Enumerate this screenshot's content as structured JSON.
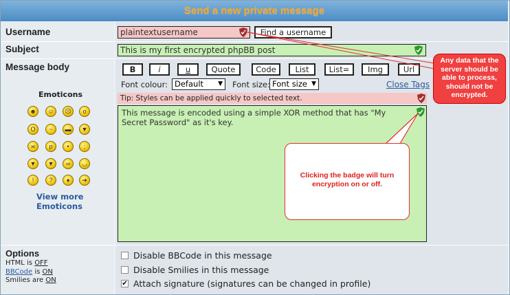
{
  "header": {
    "title": "Send a new private message"
  },
  "username": {
    "label": "Username",
    "value": "plaintextusername",
    "find_button": "Find a username"
  },
  "subject": {
    "label": "Subject",
    "value": "This is my first encrypted phpBB post"
  },
  "message": {
    "label": "Message body",
    "body": "This message is encoded using a simple XOR method that has \"My Secret Password\" as it's key.",
    "tip": "Tip: Styles can be applied quickly to selected text."
  },
  "toolbar": {
    "buttons": [
      "B",
      "i",
      "u",
      "Quote",
      "Code",
      "List",
      "List=",
      "Img",
      "Url"
    ],
    "font_colour_label": "Font colour:",
    "font_colour_value": "Default",
    "font_size_label": "Font size:",
    "font_size_value": "Font size",
    "close_tags": "Close Tags"
  },
  "emoticons": {
    "title": "Emoticons",
    "view_more_line1": "View more",
    "view_more_line2": "Emoticons",
    "faces": [
      "grin",
      "smile",
      "sad",
      "surprised",
      "eek",
      "confused",
      "cool",
      "laughing",
      "mad",
      "razz",
      "embarrassed",
      "crying",
      "evil",
      "twisted",
      "rolleyes",
      "wink",
      "exclaim",
      "question",
      "idea",
      "arrow"
    ]
  },
  "options": {
    "title": "Options",
    "html_prefix": "HTML is ",
    "html_value": "OFF",
    "bbcode_label": "BBCode",
    "bbcode_mid": " is ",
    "bbcode_value": "ON",
    "smilies_prefix": "Smilies are ",
    "smilies_value": "ON",
    "checkboxes": [
      {
        "label": "Disable BBCode in this message",
        "checked": false
      },
      {
        "label": "Disable Smilies in this message",
        "checked": false
      },
      {
        "label": "Attach signature (signatures can be changed in profile)",
        "checked": true
      }
    ]
  },
  "callouts": {
    "top": "Any data that the server should be able to process, should not be encrypted.",
    "middle": "Clicking the badge will turn encryption on or off."
  },
  "colors": {
    "field_green": "#c8f0b4",
    "field_pink": "#f6c7c7",
    "header_text": "#ffa51f",
    "callout_red": "#e02020"
  }
}
